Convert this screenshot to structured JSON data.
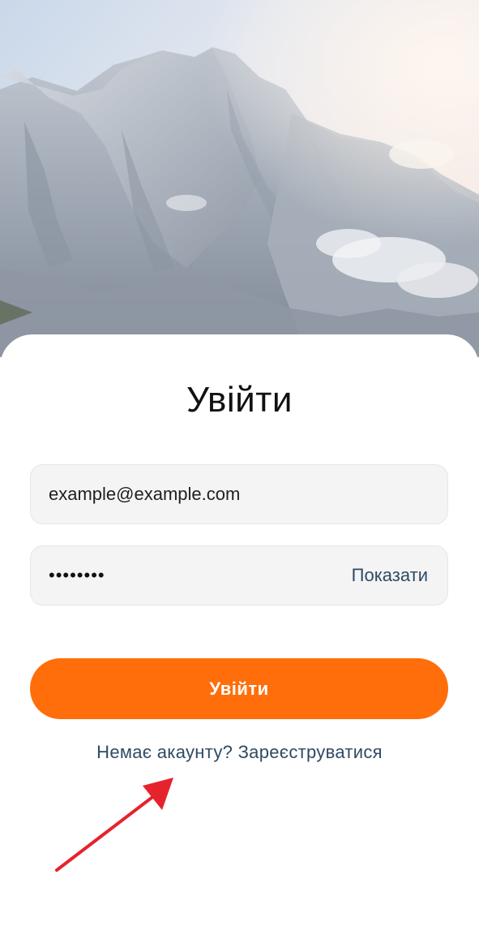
{
  "hero": {
    "image": "mountain-landscape"
  },
  "login": {
    "title": "Увійти",
    "email_value": "example@example.com",
    "password_masked": "••••••••",
    "show_password_label": "Показати",
    "submit_label": "Увійти",
    "register_prompt": "Немає акаунту? Зареєструватися"
  },
  "colors": {
    "accent": "#ff6e0b",
    "link": "#2f4a63",
    "field_bg": "#f4f4f4",
    "annotation_arrow": "#e5232d"
  },
  "annotation": {
    "icon": "red-arrow-icon"
  }
}
